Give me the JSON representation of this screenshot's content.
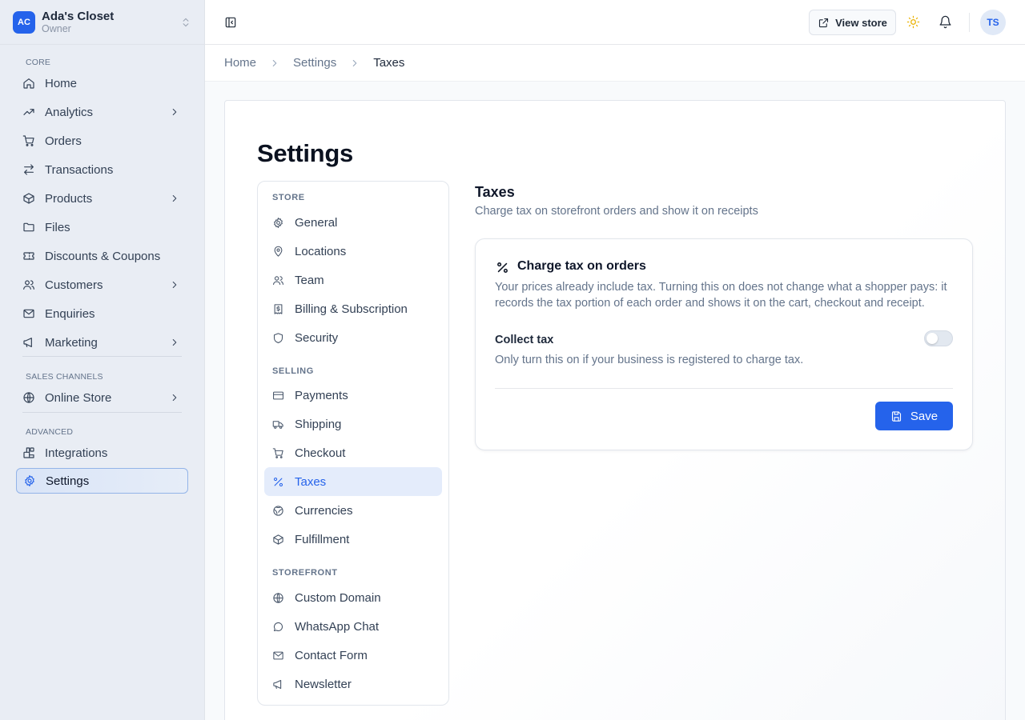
{
  "store": {
    "initials": "AC",
    "name": "Ada's Closet",
    "role": "Owner"
  },
  "sidebar": {
    "groups": [
      {
        "label": "CORE",
        "items": [
          {
            "label": "Home",
            "icon": "home-icon",
            "chevron": false
          },
          {
            "label": "Analytics",
            "icon": "trending-up-icon",
            "chevron": true
          },
          {
            "label": "Orders",
            "icon": "cart-icon",
            "chevron": false
          },
          {
            "label": "Transactions",
            "icon": "arrows-swap-icon",
            "chevron": false
          },
          {
            "label": "Products",
            "icon": "box-icon",
            "chevron": true
          },
          {
            "label": "Files",
            "icon": "folder-icon",
            "chevron": false
          },
          {
            "label": "Discounts & Coupons",
            "icon": "ticket-icon",
            "chevron": false
          },
          {
            "label": "Customers",
            "icon": "users-icon",
            "chevron": true
          },
          {
            "label": "Enquiries",
            "icon": "mail-icon",
            "chevron": false
          },
          {
            "label": "Marketing",
            "icon": "megaphone-icon",
            "chevron": true
          }
        ]
      },
      {
        "label": "SALES CHANNELS",
        "items": [
          {
            "label": "Online Store",
            "icon": "globe-icon",
            "chevron": true
          }
        ]
      },
      {
        "label": "ADVANCED",
        "items": [
          {
            "label": "Integrations",
            "icon": "blocks-icon",
            "chevron": false
          },
          {
            "label": "Settings",
            "icon": "gear-icon",
            "chevron": false,
            "active": true
          }
        ]
      }
    ]
  },
  "topbar": {
    "view_store_label": "View store",
    "user_initials": "TS"
  },
  "breadcrumb": [
    "Home",
    "Settings",
    "Taxes"
  ],
  "page": {
    "title": "Settings"
  },
  "settings_nav": {
    "groups": [
      {
        "label": "STORE",
        "items": [
          {
            "label": "General",
            "icon": "gear-icon"
          },
          {
            "label": "Locations",
            "icon": "map-pin-icon"
          },
          {
            "label": "Team",
            "icon": "users-icon"
          },
          {
            "label": "Billing & Subscription",
            "icon": "receipt-icon"
          },
          {
            "label": "Security",
            "icon": "shield-icon"
          }
        ]
      },
      {
        "label": "SELLING",
        "items": [
          {
            "label": "Payments",
            "icon": "credit-card-icon"
          },
          {
            "label": "Shipping",
            "icon": "truck-icon"
          },
          {
            "label": "Checkout",
            "icon": "cart-icon"
          },
          {
            "label": "Taxes",
            "icon": "percent-icon",
            "active": true
          },
          {
            "label": "Currencies",
            "icon": "coins-icon"
          },
          {
            "label": "Fulfillment",
            "icon": "box-icon"
          }
        ]
      },
      {
        "label": "STOREFRONT",
        "items": [
          {
            "label": "Custom Domain",
            "icon": "globe-icon"
          },
          {
            "label": "WhatsApp Chat",
            "icon": "chat-bubble-icon"
          },
          {
            "label": "Contact Form",
            "icon": "mail-icon"
          },
          {
            "label": "Newsletter",
            "icon": "megaphone-icon"
          }
        ]
      }
    ]
  },
  "taxes": {
    "title": "Taxes",
    "subtitle": "Charge tax on storefront orders and show it on receipts",
    "card": {
      "title": "Charge tax on orders",
      "description": "Your prices already include tax. Turning this on does not change what a shopper pays: it records the tax portion of each order and shows it on the cart, checkout and receipt.",
      "field_label": "Collect tax",
      "field_help": "Only turn this on if your business is registered to charge tax.",
      "toggle_on": false,
      "save_label": "Save"
    }
  },
  "colors": {
    "accent": "#2563eb",
    "sun": "#eab308"
  }
}
